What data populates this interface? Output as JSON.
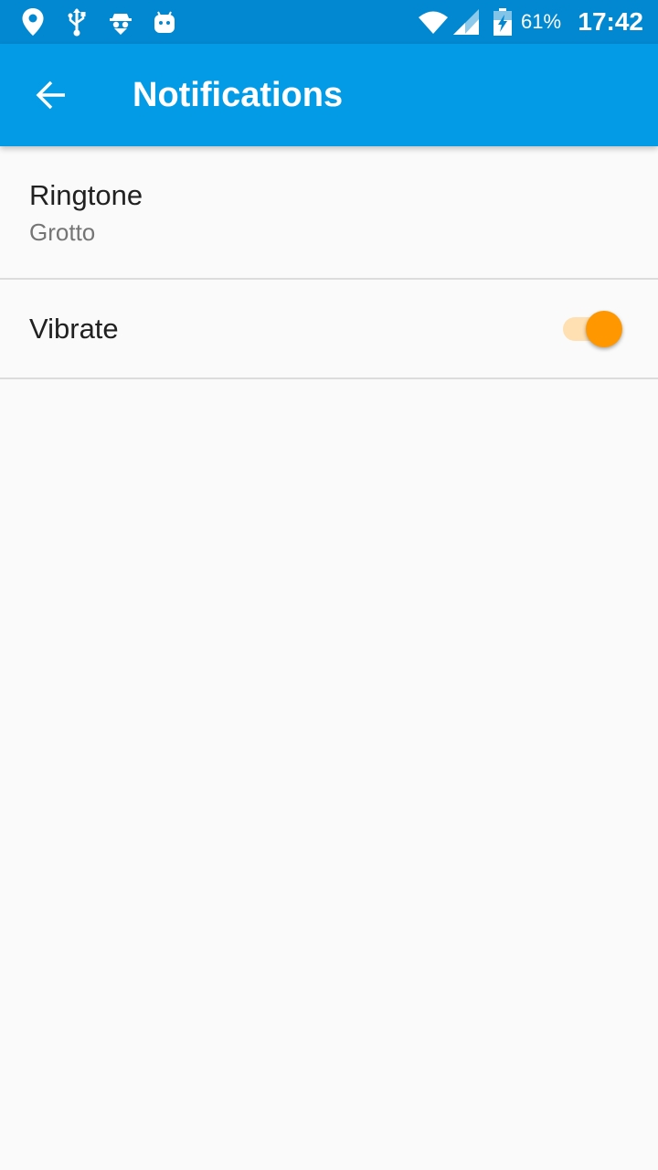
{
  "status_bar": {
    "icons": [
      "location-pin-icon",
      "usb-icon",
      "incognito-icon",
      "android-icon",
      "wifi-icon",
      "cell-signal-icon",
      "battery-charging-icon"
    ],
    "battery_percent": "61%",
    "time": "17:42"
  },
  "app_bar": {
    "back_icon": "arrow-back-icon",
    "title": "Notifications"
  },
  "preferences": {
    "ringtone": {
      "title": "Ringtone",
      "summary": "Grotto"
    },
    "vibrate": {
      "title": "Vibrate",
      "enabled": true
    }
  },
  "colors": {
    "status_bar": "#0288d1",
    "app_bar": "#039be5",
    "background": "#fafafa",
    "switch_thumb": "#ff9800",
    "switch_track": "#ffe0b2"
  }
}
